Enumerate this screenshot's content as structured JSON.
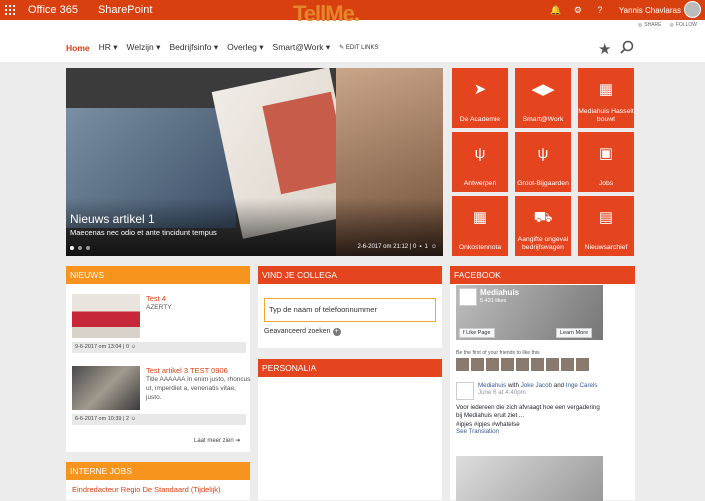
{
  "suitebar": {
    "app": "Office 365",
    "site": "SharePoint",
    "user": "Yannis Chavlaras"
  },
  "header": {
    "logo_text": "TellMe",
    "share": "SHARE",
    "follow": "FOLLOW"
  },
  "nav": {
    "items": [
      "Home",
      "HR",
      "Welzijn",
      "Bedrijfsinfo",
      "Overleg",
      "Smart@Work"
    ],
    "edit_links": "EDIT LINKS"
  },
  "hero": {
    "title": "Nieuws artikel 1",
    "subtitle": "Maecenas nec odio et ante tincidunt tempus",
    "meta": "2-6-2017 om 21:12 | 0",
    "comments": "1"
  },
  "tiles": [
    {
      "label": "De Academie",
      "icon": "paper-plane-icon",
      "glyph": "➤"
    },
    {
      "label": "Smart@Work",
      "icon": "arrows-icon",
      "glyph": "◀▶"
    },
    {
      "label": "Mediahuis Hasselt bouwt",
      "icon": "boxes-icon",
      "glyph": "▦"
    },
    {
      "label": "Antwerpen",
      "icon": "cutlery-icon",
      "glyph": "ψ"
    },
    {
      "label": "Groot-Bijgaarden",
      "icon": "cutlery-icon",
      "glyph": "ψ"
    },
    {
      "label": "Jobs",
      "icon": "briefcase-icon",
      "glyph": "▣"
    },
    {
      "label": "Onkostennota",
      "icon": "calculator-icon",
      "glyph": "▦"
    },
    {
      "label": "Aangifte ongeval bedrijfswagen",
      "icon": "car-icon",
      "glyph": "⛟"
    },
    {
      "label": "Nieuwsarchief",
      "icon": "archive-icon",
      "glyph": "▤"
    }
  ],
  "nieuws": {
    "title": "NIEUWS",
    "articles": [
      {
        "title": "Test 4",
        "desc": "AZERTY",
        "meta": "9-6-2017 om 13:04 | 0"
      },
      {
        "title": "Test artikel 3 TEST 0906",
        "desc": "Title AAAAAA In enim justo, rhoncus ut, imperdiet a, venenatis vitae, justo.",
        "meta": "6-6-2017 om 10:39 | 2"
      }
    ],
    "more": "Laat meer zien"
  },
  "collega": {
    "title": "VIND JE COLLEGA",
    "placeholder": "Typ de naam of telefoonnummer",
    "advanced": "Geavanceerd zoeken"
  },
  "personalia": {
    "title": "PERSONALIA"
  },
  "facebook": {
    "title": "FACEBOOK",
    "page_name": "Mediahuis",
    "likes": "5.431 likes",
    "like_btn": "Like Page",
    "learn_btn": "Learn More",
    "friends": "Be the first of your friends to like this",
    "post_author": "Mediahuis",
    "post_with": "with",
    "post_people": "Joke Jacob",
    "post_and": "and",
    "post_people2": "Inge Carels",
    "post_time": "June 6 at 4:40pm",
    "post_text": "Voor iedereen die zich afvraagt hoe een vergadering bij Mediahuis eruit ziet ...",
    "post_tags": "#ipjes #ipjes #whatelse",
    "translation": "See Translation"
  },
  "jobs": {
    "title": "INTERNE JOBS",
    "first": "Eindredacteur Regio De Standaard (Tijdelijk)"
  }
}
